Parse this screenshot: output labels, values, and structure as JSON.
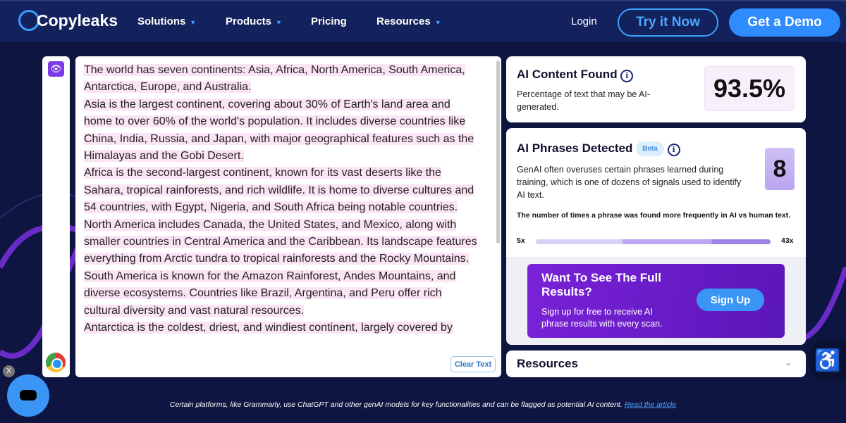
{
  "header": {
    "logo": "Copyleaks",
    "nav": [
      {
        "label": "Solutions",
        "dropdown": true
      },
      {
        "label": "Products",
        "dropdown": true
      },
      {
        "label": "Pricing",
        "dropdown": false
      },
      {
        "label": "Resources",
        "dropdown": true
      }
    ],
    "login": "Login",
    "try": "Try it Now",
    "demo": "Get a Demo"
  },
  "editor": {
    "paragraphs": [
      "The world has seven continents: Asia, Africa, North America, South America, Antarctica, Europe, and Australia.",
      "Asia is the largest continent, covering about 30% of Earth's land area and home to over 60% of the world's population. It includes diverse countries like China, India, Russia, and Japan, with major geographical features such as the Himalayas and the Gobi Desert.",
      "Africa is the second-largest continent, known for its vast deserts like the Sahara, tropical rainforests, and rich wildlife. It is home to diverse cultures and 54 countries, with Egypt, Nigeria, and South Africa being notable countries.",
      "North America includes Canada, the United States, and Mexico, along with smaller countries in Central America and the Caribbean. Its landscape features everything from Arctic tundra to tropical rainforests and the Rocky Mountains.",
      "South America is known for the Amazon Rainforest, Andes Mountains, and diverse ecosystems. Countries like Brazil, Argentina, and Peru offer rich cultural diversity and vast natural resources.",
      "Antarctica is the coldest, driest, and windiest continent, largely covered by"
    ],
    "clear": "Clear Text"
  },
  "ai_content": {
    "title": "AI Content Found",
    "desc": "Percentage of text that may be AI-generated.",
    "value": "93.5%"
  },
  "ai_phrases": {
    "title": "AI Phrases Detected",
    "badge": "Beta",
    "desc": "GenAI often overuses certain phrases learned during training, which is one of dozens of signals used to identify AI text.",
    "count": "8",
    "scale_label": "The number of times a phrase was found more frequently in AI vs human text.",
    "min": "5x",
    "max": "43x"
  },
  "promo": {
    "title": "Want To See The Full Results?",
    "desc": "Sign up for free to receive AI phrase results with every scan.",
    "button": "Sign Up"
  },
  "resources": {
    "label": "Resources"
  },
  "footer": {
    "text": "Certain platforms, like Grammarly, use ChatGPT and other genAI models for key functionalities and can be flagged as potential AI content.",
    "link": "Read the article"
  },
  "widgets": {
    "close": "X"
  }
}
